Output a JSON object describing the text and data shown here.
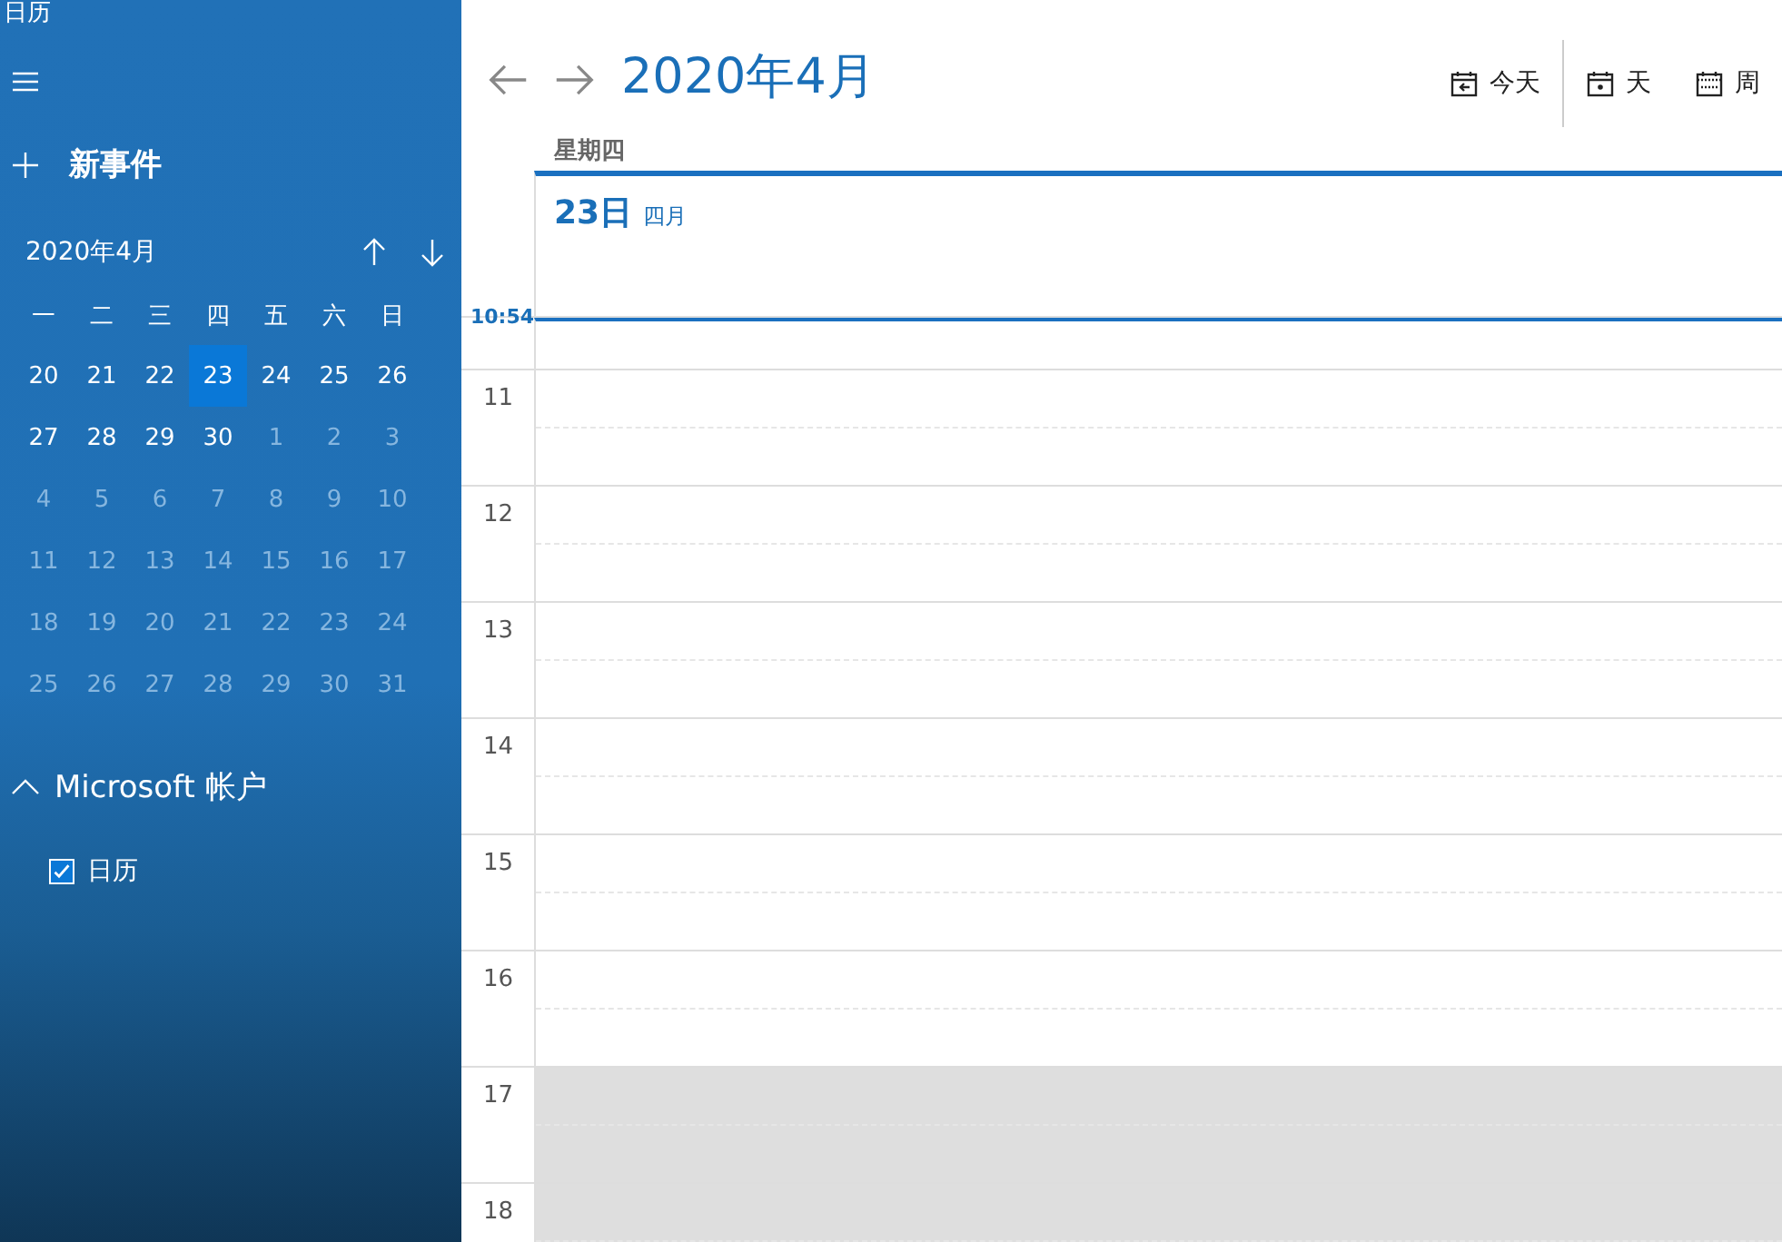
{
  "app_title": "日历",
  "new_event": "新事件",
  "mini_calendar": {
    "month": "2020年4月",
    "weekdays": [
      "一",
      "二",
      "三",
      "四",
      "五",
      "六",
      "日"
    ],
    "days": [
      {
        "day": "20",
        "in_month": true,
        "selected": false
      },
      {
        "day": "21",
        "in_month": true,
        "selected": false
      },
      {
        "day": "22",
        "in_month": true,
        "selected": false
      },
      {
        "day": "23",
        "in_month": true,
        "selected": true
      },
      {
        "day": "24",
        "in_month": true,
        "selected": false
      },
      {
        "day": "25",
        "in_month": true,
        "selected": false
      },
      {
        "day": "26",
        "in_month": true,
        "selected": false
      },
      {
        "day": "27",
        "in_month": true,
        "selected": false
      },
      {
        "day": "28",
        "in_month": true,
        "selected": false
      },
      {
        "day": "29",
        "in_month": true,
        "selected": false
      },
      {
        "day": "30",
        "in_month": true,
        "selected": false
      },
      {
        "day": "1",
        "in_month": false,
        "selected": false
      },
      {
        "day": "2",
        "in_month": false,
        "selected": false
      },
      {
        "day": "3",
        "in_month": false,
        "selected": false
      },
      {
        "day": "4",
        "in_month": false,
        "selected": false
      },
      {
        "day": "5",
        "in_month": false,
        "selected": false
      },
      {
        "day": "6",
        "in_month": false,
        "selected": false
      },
      {
        "day": "7",
        "in_month": false,
        "selected": false
      },
      {
        "day": "8",
        "in_month": false,
        "selected": false
      },
      {
        "day": "9",
        "in_month": false,
        "selected": false
      },
      {
        "day": "10",
        "in_month": false,
        "selected": false
      },
      {
        "day": "11",
        "in_month": false,
        "selected": false
      },
      {
        "day": "12",
        "in_month": false,
        "selected": false
      },
      {
        "day": "13",
        "in_month": false,
        "selected": false
      },
      {
        "day": "14",
        "in_month": false,
        "selected": false
      },
      {
        "day": "15",
        "in_month": false,
        "selected": false
      },
      {
        "day": "16",
        "in_month": false,
        "selected": false
      },
      {
        "day": "17",
        "in_month": false,
        "selected": false
      },
      {
        "day": "18",
        "in_month": false,
        "selected": false
      },
      {
        "day": "19",
        "in_month": false,
        "selected": false
      },
      {
        "day": "20",
        "in_month": false,
        "selected": false
      },
      {
        "day": "21",
        "in_month": false,
        "selected": false
      },
      {
        "day": "22",
        "in_month": false,
        "selected": false
      },
      {
        "day": "23",
        "in_month": false,
        "selected": false
      },
      {
        "day": "24",
        "in_month": false,
        "selected": false
      },
      {
        "day": "25",
        "in_month": false,
        "selected": false
      },
      {
        "day": "26",
        "in_month": false,
        "selected": false
      },
      {
        "day": "27",
        "in_month": false,
        "selected": false
      },
      {
        "day": "28",
        "in_month": false,
        "selected": false
      },
      {
        "day": "29",
        "in_month": false,
        "selected": false
      },
      {
        "day": "30",
        "in_month": false,
        "selected": false
      },
      {
        "day": "31",
        "in_month": false,
        "selected": false
      }
    ]
  },
  "accounts": [
    {
      "name": "Microsoft 帐户",
      "expanded": true,
      "calendars": [
        {
          "name": "日历",
          "checked": true
        }
      ]
    }
  ],
  "header": {
    "title": "2020年4月",
    "views": [
      {
        "label": "今天",
        "kind": "today"
      },
      {
        "label": "天",
        "kind": "day"
      },
      {
        "label": "周",
        "kind": "week"
      }
    ]
  },
  "day_view": {
    "weekday": "星期四",
    "date": "23日",
    "month": "四月",
    "now": "10:54",
    "hours": [
      {
        "label": "11",
        "off_hours": false
      },
      {
        "label": "12",
        "off_hours": false
      },
      {
        "label": "13",
        "off_hours": false
      },
      {
        "label": "14",
        "off_hours": false
      },
      {
        "label": "15",
        "off_hours": false
      },
      {
        "label": "16",
        "off_hours": false
      },
      {
        "label": "17",
        "off_hours": true
      },
      {
        "label": "18",
        "off_hours": true
      }
    ]
  }
}
